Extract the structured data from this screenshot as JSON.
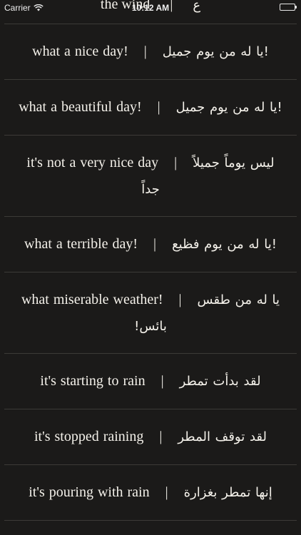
{
  "status_bar": {
    "carrier": "Carrier",
    "time": "10:12 AM"
  },
  "top_partial": {
    "left": "the wind",
    "right": "ع"
  },
  "phrases": [
    {
      "english": "what a nice day!",
      "arabic": "!يا له من يوم جميل"
    },
    {
      "english": "what a beautiful day!",
      "arabic": "!يا له من يوم جميل"
    },
    {
      "english": "it's not a very nice day",
      "arabic": "ليس يوماً جميلاً جداً"
    },
    {
      "english": "what a terrible day!",
      "arabic": "!يا له من يوم فظيع"
    },
    {
      "english": "what miserable weather!",
      "arabic": "يا له من طقس بائس!"
    },
    {
      "english": "it's starting to rain",
      "arabic": "لقد بدأت تمطر"
    },
    {
      "english": "it's stopped raining",
      "arabic": "لقد توقف المطر"
    },
    {
      "english": "it's pouring with rain",
      "arabic": "إنها تمطر بغزارة"
    }
  ],
  "separator": "|"
}
